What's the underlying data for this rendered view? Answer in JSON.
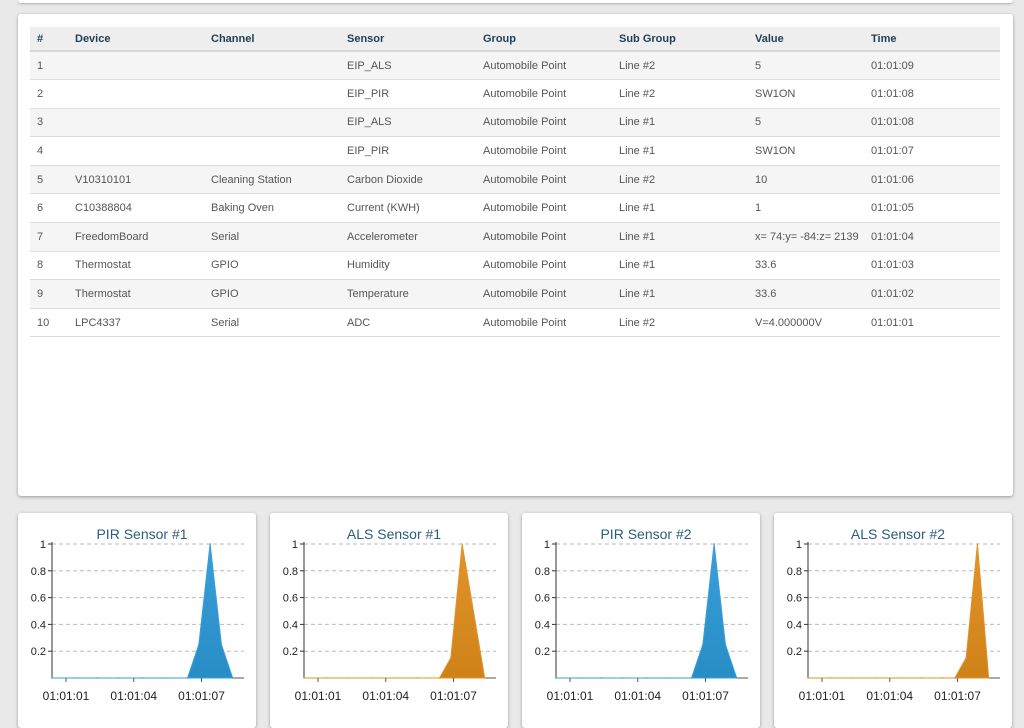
{
  "table": {
    "columns": [
      "#",
      "Device",
      "Channel",
      "Sensor",
      "Group",
      "Sub Group",
      "Value",
      "Time"
    ],
    "rows": [
      [
        "1",
        "",
        "",
        "EIP_ALS",
        "Automobile Point",
        "Line #2",
        "5",
        "01:01:09"
      ],
      [
        "2",
        "",
        "",
        "EIP_PIR",
        "Automobile Point",
        "Line #2",
        "SW1ON",
        "01:01:08"
      ],
      [
        "3",
        "",
        "",
        "EIP_ALS",
        "Automobile Point",
        "Line #1",
        "5",
        "01:01:08"
      ],
      [
        "4",
        "",
        "",
        "EIP_PIR",
        "Automobile Point",
        "Line #1",
        "SW1ON",
        "01:01:07"
      ],
      [
        "5",
        "V10310101",
        "Cleaning Station",
        "Carbon Dioxide",
        "Automobile Point",
        "Line #2",
        "10",
        "01:01:06"
      ],
      [
        "6",
        "C10388804",
        "Baking Oven",
        "Current (KWH)",
        "Automobile Point",
        "Line #1",
        "1",
        "01:01:05"
      ],
      [
        "7",
        "FreedomBoard",
        "Serial",
        "Accelerometer",
        "Automobile Point",
        "Line #1",
        "x= 74:y= -84:z= 2139",
        "01:01:04"
      ],
      [
        "8",
        "Thermostat",
        "GPIO",
        "Humidity",
        "Automobile Point",
        "Line #1",
        "33.6",
        "01:01:03"
      ],
      [
        "9",
        "Thermostat",
        "GPIO",
        "Temperature",
        "Automobile Point",
        "Line #1",
        "33.6",
        "01:01:02"
      ],
      [
        "10",
        "LPC4337",
        "Serial",
        "ADC",
        "Automobile Point",
        "Line #2",
        "V=4.000000V",
        "01:01:01"
      ]
    ]
  },
  "chart_data": [
    {
      "type": "area",
      "title": "PIR Sensor #1",
      "color": "#3a9fd8",
      "ylim": [
        0,
        1
      ],
      "yticks": [
        "0.2",
        "0.4",
        "0.6",
        "0.8",
        "1"
      ],
      "xticks": [
        "01:01:01",
        "01:01:04",
        "01:01:07"
      ],
      "x": [
        0,
        1,
        2,
        3,
        4,
        5,
        6,
        6.5,
        7,
        7.5,
        8
      ],
      "values": [
        0,
        0,
        0,
        0,
        0,
        0,
        0,
        0.25,
        1,
        0.25,
        0
      ],
      "grid": true
    },
    {
      "type": "area",
      "title": "ALS Sensor #1",
      "color": "#e0942a",
      "ylim": [
        0,
        1
      ],
      "yticks": [
        "0.2",
        "0.4",
        "0.6",
        "0.8",
        "1"
      ],
      "xticks": [
        "01:01:01",
        "01:01:04",
        "01:01:07"
      ],
      "x": [
        0,
        1,
        2,
        3,
        4,
        5,
        6,
        6.5,
        7,
        7.5,
        8
      ],
      "values": [
        0,
        0,
        0,
        0,
        0,
        0,
        0,
        0.15,
        1,
        0.5,
        0
      ],
      "grid": true
    },
    {
      "type": "area",
      "title": "PIR Sensor #2",
      "color": "#3a9fd8",
      "ylim": [
        0,
        1
      ],
      "yticks": [
        "0.2",
        "0.4",
        "0.6",
        "0.8",
        "1"
      ],
      "xticks": [
        "01:01:01",
        "01:01:04",
        "01:01:07"
      ],
      "x": [
        0,
        1,
        2,
        3,
        4,
        5,
        6,
        6.5,
        7,
        7.5,
        8
      ],
      "values": [
        0,
        0,
        0,
        0,
        0,
        0,
        0,
        0.25,
        1,
        0.25,
        0
      ],
      "grid": true
    },
    {
      "type": "area",
      "title": "ALS Sensor #2",
      "color": "#e0942a",
      "ylim": [
        0,
        1
      ],
      "yticks": [
        "0.2",
        "0.4",
        "0.6",
        "0.8",
        "1"
      ],
      "xticks": [
        "01:01:01",
        "01:01:04",
        "01:01:07"
      ],
      "x": [
        0,
        1,
        2,
        3,
        4,
        5,
        6,
        6.5,
        7,
        7.5,
        8
      ],
      "values": [
        0,
        0,
        0,
        0,
        0,
        0,
        0,
        0,
        0.15,
        1,
        0
      ],
      "grid": true
    }
  ]
}
